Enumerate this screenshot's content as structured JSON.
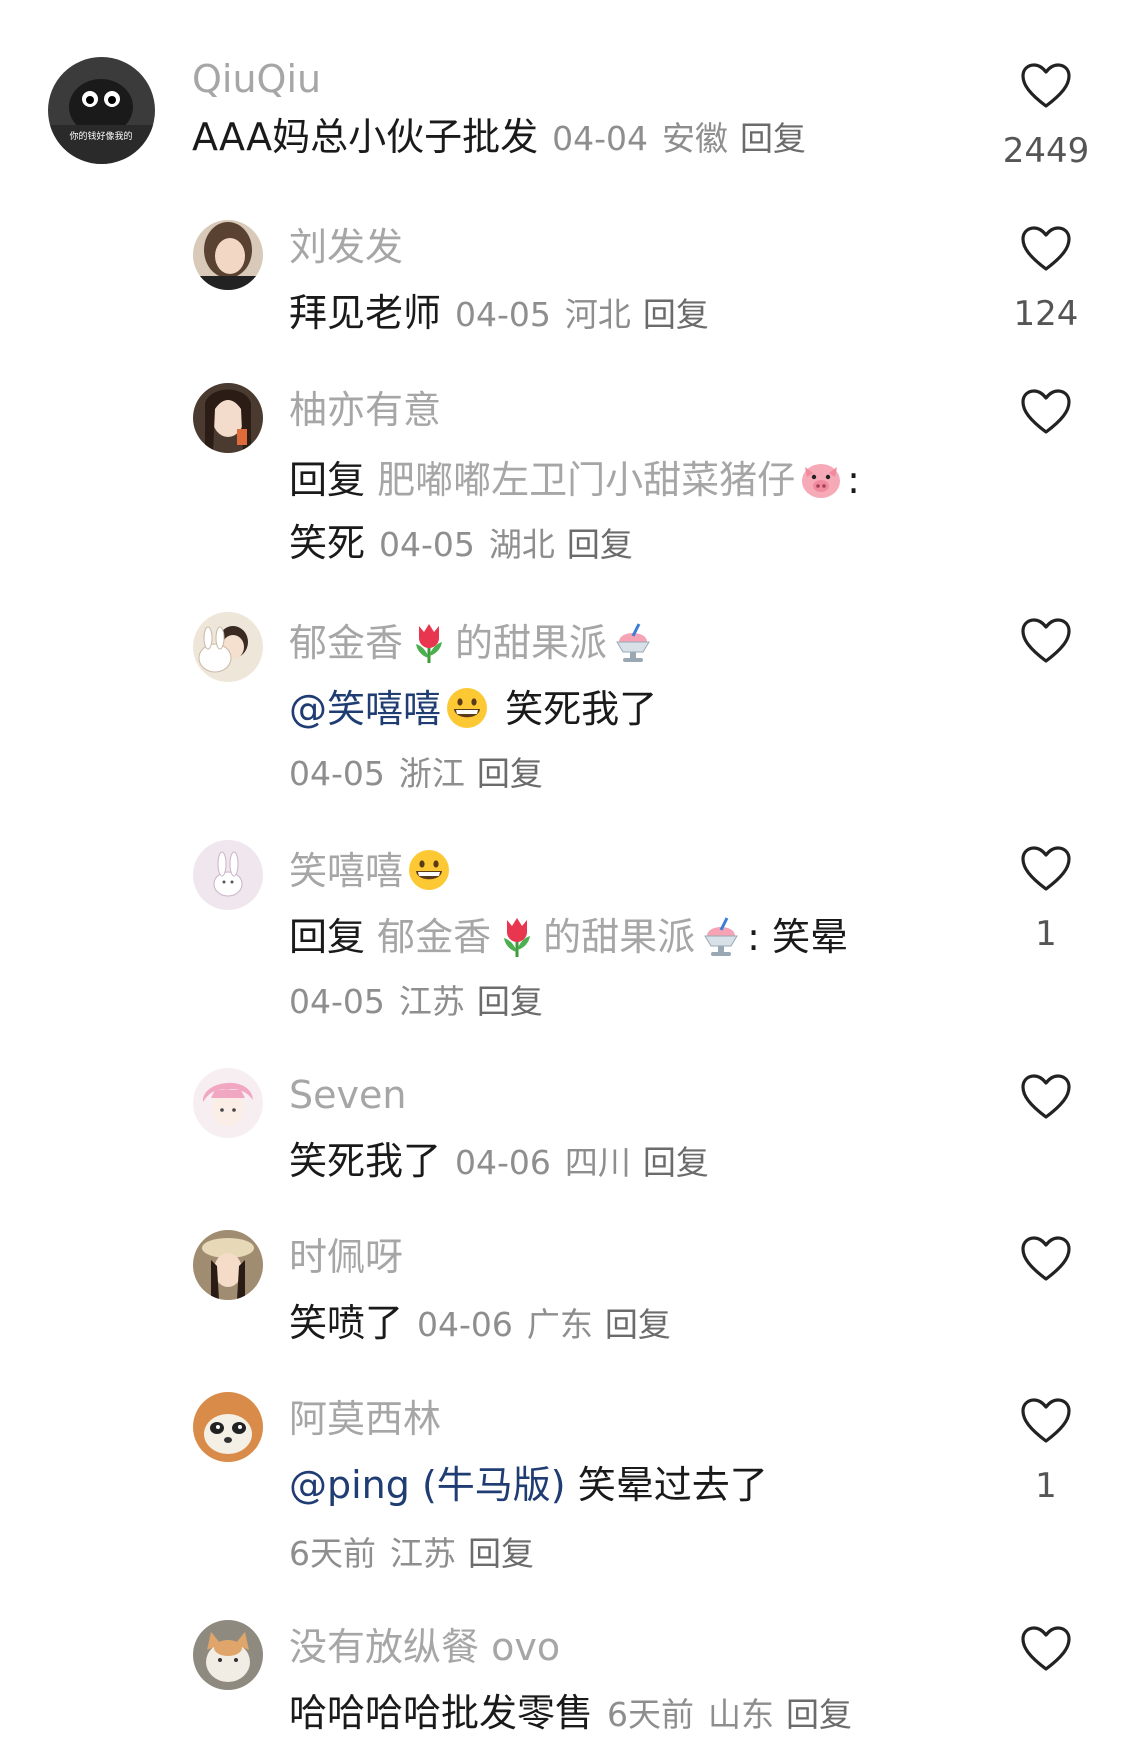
{
  "comments": [
    {
      "name": "QiuQiu",
      "avatar_text": "你的钱好像我的",
      "text": "AAA妈总小伙子批发",
      "date": "04-04",
      "region": "安徽",
      "reply": "回复",
      "likes": "2449"
    },
    {
      "name": "刘发发",
      "text": "拜见老师",
      "date": "04-05",
      "region": "河北",
      "reply": "回复",
      "likes": "124"
    },
    {
      "name": "柚亦有意",
      "reply_prefix": "回复",
      "reply_target": "肥嘟嘟左卫门小甜菜猪仔",
      "target_emoji": "pig-face-emoji",
      "colon": ":",
      "text": "笑死",
      "date": "04-05",
      "region": "湖北",
      "reply": "回复",
      "likes": ""
    },
    {
      "name_part1": "郁金香",
      "name_emoji1": "tulip-emoji",
      "name_part2": "的甜果派",
      "name_emoji2": "shaved-ice-emoji",
      "mention": "@笑嘻嘻",
      "mention_emoji": "grinning-face-emoji",
      "text": "笑死我了",
      "date": "04-05",
      "region": "浙江",
      "reply": "回复",
      "likes": ""
    },
    {
      "name": "笑嘻嘻",
      "name_emoji": "grinning-face-emoji",
      "reply_prefix": "回复",
      "target_part1": "郁金香",
      "target_emoji1": "tulip-emoji",
      "target_part2": "的甜果派",
      "target_emoji2": "shaved-ice-emoji",
      "colon": ":",
      "text": "笑晕",
      "date": "04-05",
      "region": "江苏",
      "reply": "回复",
      "likes": "1"
    },
    {
      "name": "Seven",
      "text": "笑死我了",
      "date": "04-06",
      "region": "四川",
      "reply": "回复",
      "likes": ""
    },
    {
      "name": "时佩呀",
      "text": "笑喷了",
      "date": "04-06",
      "region": "广东",
      "reply": "回复",
      "likes": ""
    },
    {
      "name": "阿莫西林",
      "mention": "@ping (牛马版)",
      "text": "笑晕过去了",
      "date": "6天前",
      "region": "江苏",
      "reply": "回复",
      "likes": "1"
    },
    {
      "name": "没有放纵餐 ovo",
      "text": "哈哈哈哈批发零售",
      "date": "6天前",
      "region": "山东",
      "reply": "回复",
      "likes": ""
    }
  ],
  "colors": {
    "name_grey": "#a6a6a6",
    "meta_grey": "#8e8e8e",
    "mention_blue": "#1f3c73",
    "text": "#1a1a1a"
  }
}
